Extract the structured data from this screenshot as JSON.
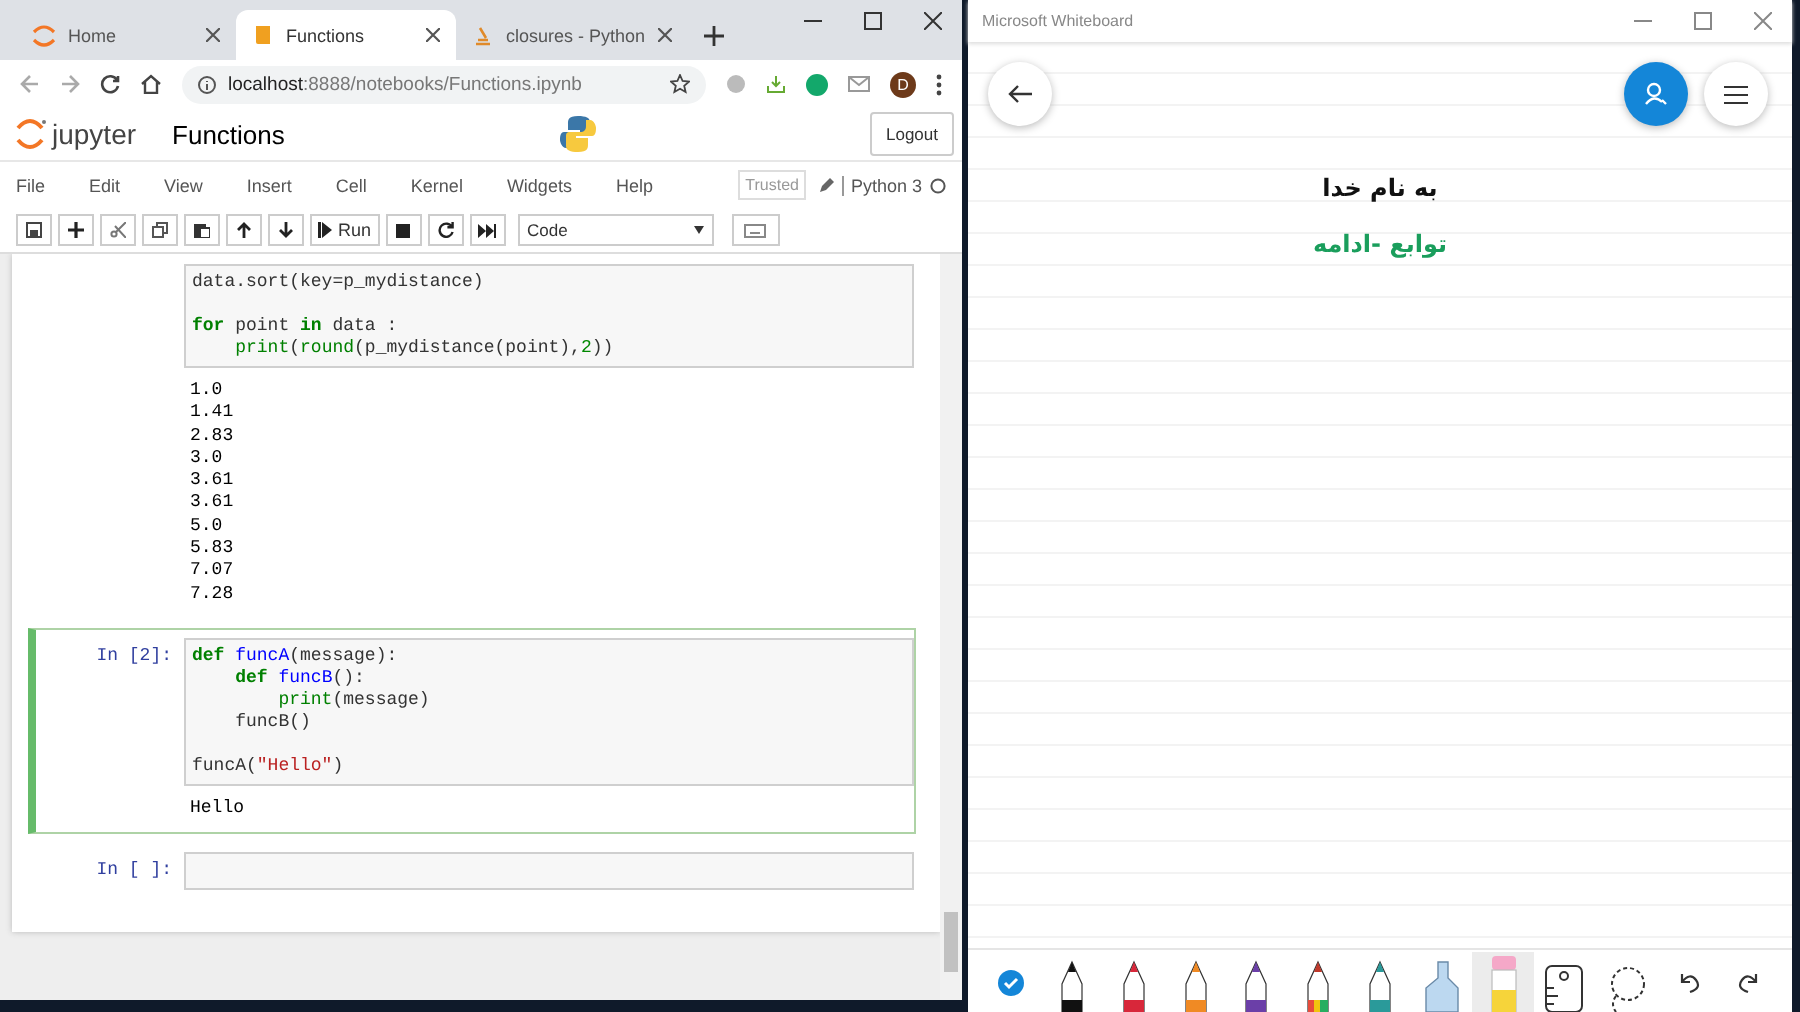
{
  "browser": {
    "tabs": [
      {
        "title": "Home",
        "selected": false
      },
      {
        "title": "Functions",
        "selected": true
      },
      {
        "title": "closures - Python",
        "selected": false
      }
    ],
    "url_host": "localhost",
    "url_rest": ":8888/notebooks/Functions.ipynb",
    "profile_initial": "D"
  },
  "jupyter": {
    "logo_text": "jupyter",
    "notebook_name": "Functions",
    "logout": "Logout",
    "menu": [
      "File",
      "Edit",
      "View",
      "Insert",
      "Cell",
      "Kernel",
      "Widgets",
      "Help"
    ],
    "trusted": "Trusted",
    "kernel": "Python 3",
    "run": "Run",
    "cell_type": "Code"
  },
  "cells": [
    {
      "selected": false,
      "code": [
        {
          "tokens": [
            {
              "text": "data.sort(key=p_mydistance)",
              "kind": "plain"
            }
          ]
        },
        {
          "gap_before": true,
          "tokens": [
            {
              "text": "for",
              "kind": "keyword"
            },
            {
              "text": " point ",
              "kind": "plain"
            },
            {
              "text": "in",
              "kind": "keyword"
            },
            {
              "text": " data :",
              "kind": "plain"
            }
          ]
        },
        {
          "tokens": [
            {
              "text": "    print",
              "kind": "builtin"
            },
            {
              "text": "(",
              "kind": "plain"
            },
            {
              "text": "round",
              "kind": "builtin"
            },
            {
              "text": "(p_mydistance(point),",
              "kind": "plain"
            },
            {
              "text": "2",
              "kind": "number"
            },
            {
              "text": "))",
              "kind": "plain"
            }
          ]
        }
      ],
      "output": [
        "1.0",
        "1.41",
        "2.83",
        "3.0",
        "3.61",
        "3.61",
        "5.0",
        "5.83",
        "7.07",
        "7.28"
      ]
    },
    {
      "prompt": "In [2]:",
      "selected": true,
      "code": [
        {
          "tokens": [
            {
              "text": "def",
              "kind": "keyword"
            },
            {
              "text": " funcA",
              "kind": "function"
            },
            {
              "text": "(message):",
              "kind": "plain"
            }
          ]
        },
        {
          "tokens": [
            {
              "text": "    def",
              "kind": "keyword"
            },
            {
              "text": " funcB",
              "kind": "function"
            },
            {
              "text": "():",
              "kind": "plain"
            }
          ]
        },
        {
          "tokens": [
            {
              "text": "        print",
              "kind": "builtin"
            },
            {
              "text": "(message)",
              "kind": "plain"
            }
          ]
        },
        {
          "tokens": [
            {
              "text": "    funcB()",
              "kind": "plain"
            }
          ]
        },
        {
          "gap_before": true,
          "tokens": [
            {
              "text": "funcA(",
              "kind": "plain"
            },
            {
              "text": "\"Hello\"",
              "kind": "string"
            },
            {
              "text": ")",
              "kind": "plain"
            }
          ]
        }
      ],
      "output": [
        "Hello"
      ]
    },
    {
      "prompt": "In [ ]:",
      "selected": false
    }
  ],
  "whiteboard": {
    "title": "Microsoft Whiteboard",
    "lines": [
      {
        "text": "به نام خدا",
        "color": "#111111"
      },
      {
        "text": "توابع -ادامه",
        "color": "#1a9e5c"
      }
    ],
    "tools": [
      {
        "kind": "done",
        "selected": false
      },
      {
        "kind": "pen",
        "color": "#111111",
        "selected": false
      },
      {
        "kind": "pen",
        "color": "#d8273a",
        "selected": false
      },
      {
        "kind": "pen",
        "color": "#f08a24",
        "selected": false
      },
      {
        "kind": "pen",
        "color": "#6b3fa8",
        "selected": false
      },
      {
        "kind": "rainbow_pen",
        "selected": false
      },
      {
        "kind": "pen",
        "color": "#2a9a9a",
        "selected": false
      },
      {
        "kind": "highlighter",
        "color": "#bcd8f0",
        "selected": false
      },
      {
        "kind": "pencil",
        "color": "#f6d43a",
        "selected": true
      },
      {
        "kind": "ruler",
        "selected": false
      },
      {
        "kind": "lasso",
        "selected": false
      },
      {
        "kind": "undo",
        "selected": false
      },
      {
        "kind": "redo",
        "selected": false
      }
    ]
  }
}
